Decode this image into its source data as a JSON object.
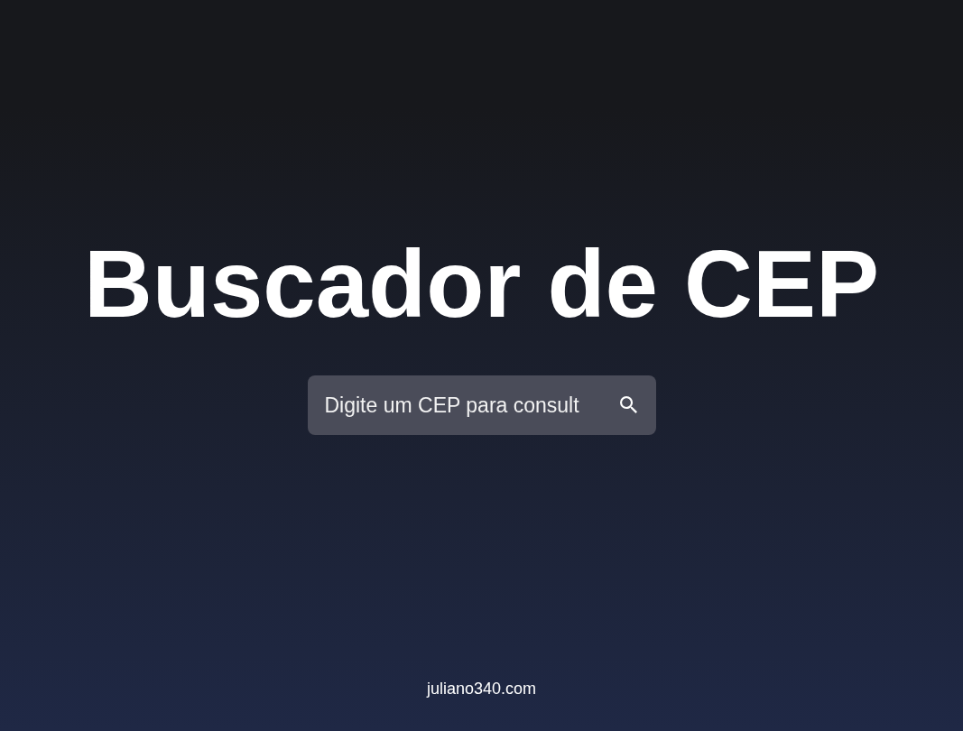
{
  "title": "Buscador de CEP",
  "search": {
    "placeholder": "Digite um CEP para consult"
  },
  "footer": {
    "link": "juliano340.com"
  }
}
